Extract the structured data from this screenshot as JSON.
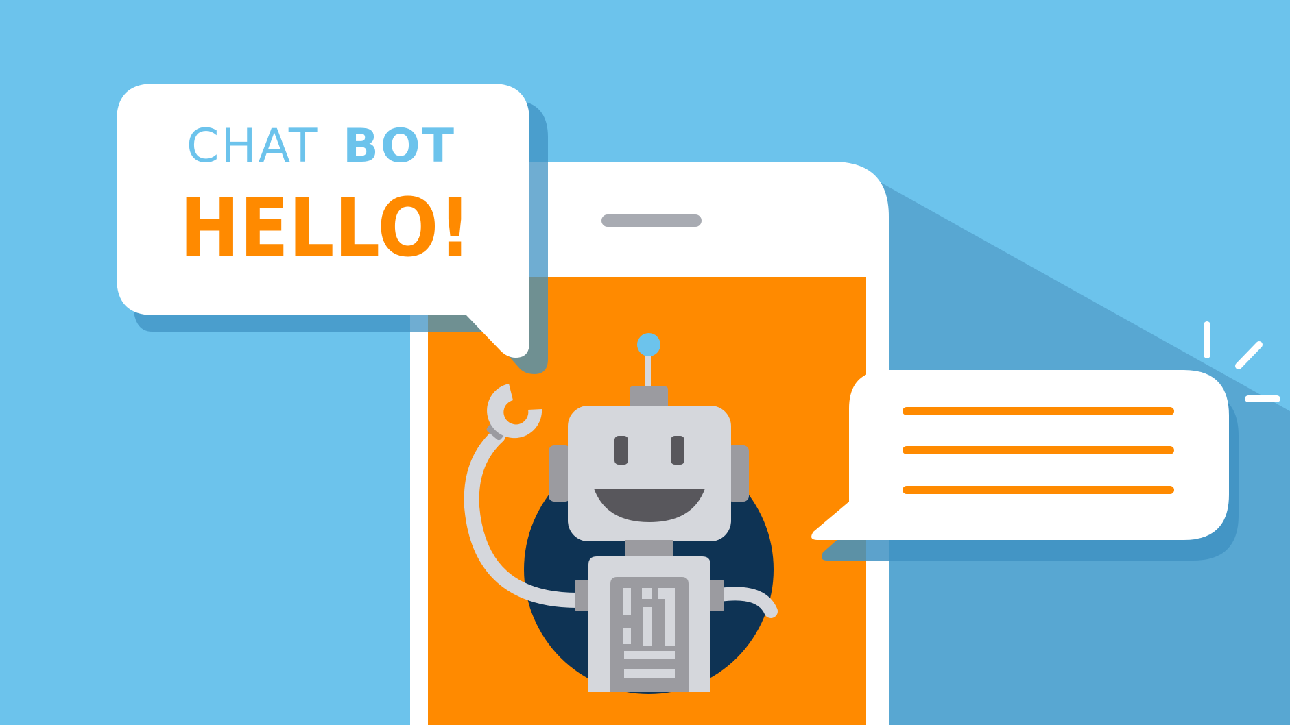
{
  "speech_bubble": {
    "line1_light": "CHAT",
    "line1_bold": "BOT",
    "headline": "HELLO!"
  },
  "colors": {
    "background": "#6CC3EC",
    "phone_screen": "#FF8A00",
    "orange_text": "#FF8A00",
    "blue_text": "#6CC3EC",
    "shadow": "#4A9CC8",
    "robot_gray": "#D5D7DC",
    "robot_dark_gray": "#9B9BA0",
    "circle_navy": "#0E3354"
  },
  "icons": [
    "robot-icon",
    "antenna-icon",
    "reply-lines-icon",
    "sparkle-icon"
  ]
}
